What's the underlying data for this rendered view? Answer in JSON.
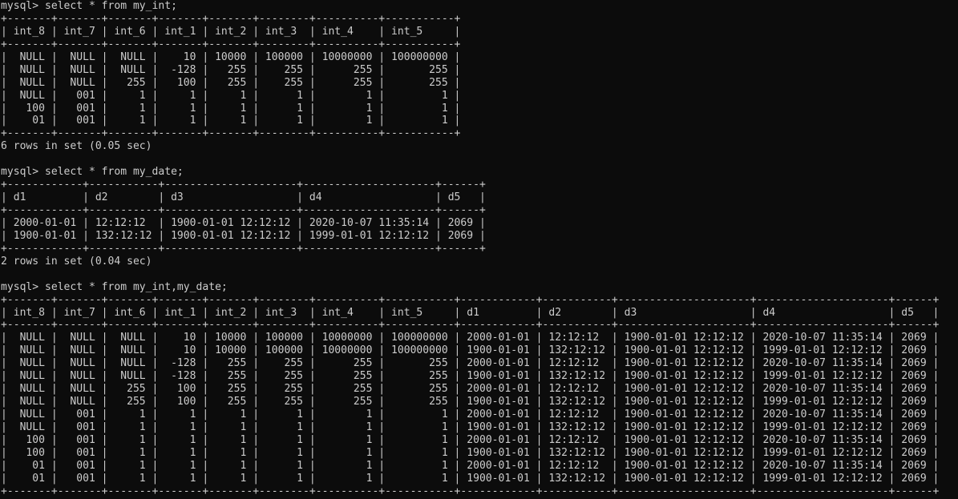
{
  "terminal": {
    "theme": {
      "background": "#0c0c0c",
      "foreground": "#cccccc"
    },
    "lines": [
      "mysql> select * from my_int;",
      "+-------+-------+-------+-------+-------+--------+----------+-----------+",
      "| int_8 | int_7 | int_6 | int_1 | int_2 | int_3  | int_4    | int_5     |",
      "+-------+-------+-------+-------+-------+--------+----------+-----------+",
      "|  NULL |  NULL |  NULL |    10 | 10000 | 100000 | 10000000 | 100000000 |",
      "|  NULL |  NULL |  NULL |  -128 |   255 |    255 |      255 |       255 |",
      "|  NULL |  NULL |   255 |   100 |   255 |    255 |      255 |       255 |",
      "|  NULL |   001 |     1 |     1 |     1 |      1 |        1 |         1 |",
      "|   100 |   001 |     1 |     1 |     1 |      1 |        1 |         1 |",
      "|    01 |   001 |     1 |     1 |     1 |      1 |        1 |         1 |",
      "+-------+-------+-------+-------+-------+--------+----------+-----------+",
      "6 rows in set (0.05 sec)",
      "",
      "mysql> select * from my_date;",
      "+------------+-----------+---------------------+---------------------+------+",
      "| d1         | d2        | d3                  | d4                  | d5   |",
      "+------------+-----------+---------------------+---------------------+------+",
      "| 2000-01-01 | 12:12:12  | 1900-01-01 12:12:12 | 2020-10-07 11:35:14 | 2069 |",
      "| 1900-01-01 | 132:12:12 | 1900-01-01 12:12:12 | 1999-01-01 12:12:12 | 2069 |",
      "+------------+-----------+---------------------+---------------------+------+",
      "2 rows in set (0.04 sec)",
      "",
      "mysql> select * from my_int,my_date;",
      "+-------+-------+-------+-------+-------+--------+----------+-----------+------------+-----------+---------------------+---------------------+------+",
      "| int_8 | int_7 | int_6 | int_1 | int_2 | int_3  | int_4    | int_5     | d1         | d2        | d3                  | d4                  | d5   |",
      "+-------+-------+-------+-------+-------+--------+----------+-----------+------------+-----------+---------------------+---------------------+------+",
      "|  NULL |  NULL |  NULL |    10 | 10000 | 100000 | 10000000 | 100000000 | 2000-01-01 | 12:12:12  | 1900-01-01 12:12:12 | 2020-10-07 11:35:14 | 2069 |",
      "|  NULL |  NULL |  NULL |    10 | 10000 | 100000 | 10000000 | 100000000 | 1900-01-01 | 132:12:12 | 1900-01-01 12:12:12 | 1999-01-01 12:12:12 | 2069 |",
      "|  NULL |  NULL |  NULL |  -128 |   255 |    255 |      255 |       255 | 2000-01-01 | 12:12:12  | 1900-01-01 12:12:12 | 2020-10-07 11:35:14 | 2069 |",
      "|  NULL |  NULL |  NULL |  -128 |   255 |    255 |      255 |       255 | 1900-01-01 | 132:12:12 | 1900-01-01 12:12:12 | 1999-01-01 12:12:12 | 2069 |",
      "|  NULL |  NULL |   255 |   100 |   255 |    255 |      255 |       255 | 2000-01-01 | 12:12:12  | 1900-01-01 12:12:12 | 2020-10-07 11:35:14 | 2069 |",
      "|  NULL |  NULL |   255 |   100 |   255 |    255 |      255 |       255 | 1900-01-01 | 132:12:12 | 1900-01-01 12:12:12 | 1999-01-01 12:12:12 | 2069 |",
      "|  NULL |   001 |     1 |     1 |     1 |      1 |        1 |         1 | 2000-01-01 | 12:12:12  | 1900-01-01 12:12:12 | 2020-10-07 11:35:14 | 2069 |",
      "|  NULL |   001 |     1 |     1 |     1 |      1 |        1 |         1 | 1900-01-01 | 132:12:12 | 1900-01-01 12:12:12 | 1999-01-01 12:12:12 | 2069 |",
      "|   100 |   001 |     1 |     1 |     1 |      1 |        1 |         1 | 2000-01-01 | 12:12:12  | 1900-01-01 12:12:12 | 2020-10-07 11:35:14 | 2069 |",
      "|   100 |   001 |     1 |     1 |     1 |      1 |        1 |         1 | 1900-01-01 | 132:12:12 | 1900-01-01 12:12:12 | 1999-01-01 12:12:12 | 2069 |",
      "|    01 |   001 |     1 |     1 |     1 |      1 |        1 |         1 | 2000-01-01 | 12:12:12  | 1900-01-01 12:12:12 | 2020-10-07 11:35:14 | 2069 |",
      "|    01 |   001 |     1 |     1 |     1 |      1 |        1 |         1 | 1900-01-01 | 132:12:12 | 1900-01-01 12:12:12 | 1999-01-01 12:12:12 | 2069 |",
      "+-------+-------+-------+-------+-------+--------+----------+-----------+------------+-----------+---------------------+---------------------+------+"
    ]
  }
}
